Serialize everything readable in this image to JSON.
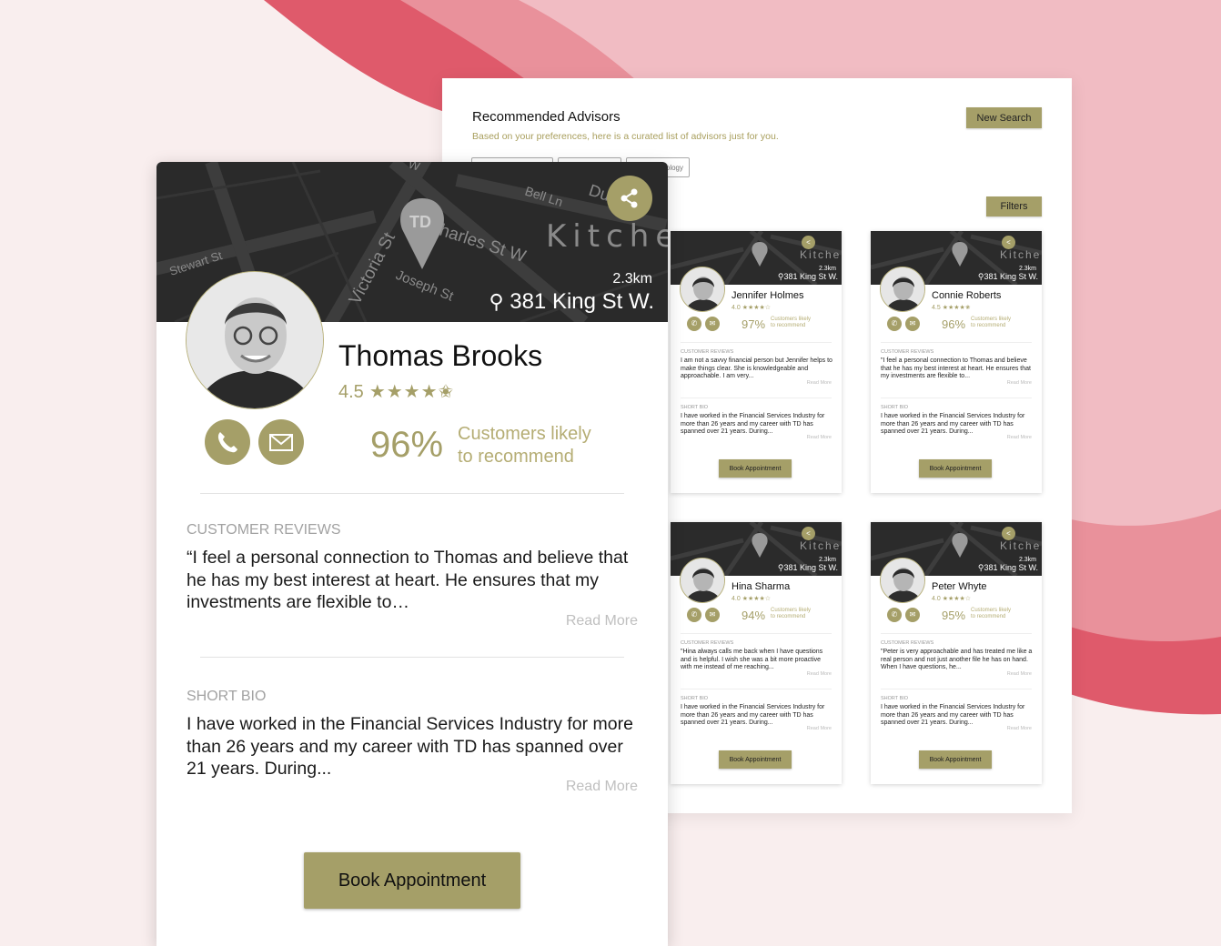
{
  "panel": {
    "title": "Recommended Advisors",
    "subtitle": "Based on your preferences, here is a curated list of advisors just for you.",
    "new_search": "New Search",
    "filters": "Filters",
    "chips": [
      "",
      "",
      "ology"
    ]
  },
  "labels": {
    "map_city": "Kitche",
    "customer_reviews_small": "CUSTOMER REVIEWS",
    "short_bio_small": "SHORT BIO",
    "customer_reviews": "CUSTOMER REVIEWS",
    "short_bio": "SHORT BIO",
    "read_more": "Read More",
    "likely_small": "Customers likely to recommend",
    "likely_l1": "Customers likely",
    "likely_l2": "to recommend",
    "book": "Book Appointment"
  },
  "streets": {
    "stewart": "Stewart St",
    "victoria": "Victoria St",
    "charles": "harles St W",
    "joseph": "Joseph St",
    "bell": "Bell Ln",
    "du": "Du",
    "w": "W"
  },
  "main": {
    "name": "Thomas Brooks",
    "rating": "4.5",
    "stars": "★★★★✬",
    "distance": "2.3km",
    "address": "381 King St W.",
    "percent": "96%",
    "review": "“I feel a personal connection to Thomas and believe that he has my best interest at heart. He ensures that my investments are flexible to…",
    "bio": "I have worked in the Financial Services Industry for more than 26 years and my career with TD has spanned over 21 years. During..."
  },
  "advisors": [
    {
      "name": "Jennifer Holmes",
      "rating": "4.0",
      "stars": "★★★★☆",
      "distance": "2.3km",
      "address": "381 King St W.",
      "percent": "97%",
      "review": "I am not a savvy financial person but Jennifer helps to make things clear. She is knowledgeable and approachable. I am very...",
      "bio": "I have worked in the Financial Services Industry for more than 26 years and my career with TD has spanned over 21 years. During..."
    },
    {
      "name": "Connie Roberts",
      "rating": "4.5",
      "stars": "★★★★✬",
      "distance": "2.3km",
      "address": "381 King St W.",
      "percent": "96%",
      "review": "\"I feel a personal connection to Thomas and believe that he has my best interest at heart. He ensures that my investments are flexible to...",
      "bio": "I have worked in the Financial Services Industry for more than 26 years and my career with TD has spanned over 21 years. During..."
    },
    {
      "name": "Hina Sharma",
      "rating": "4.0",
      "stars": "★★★★☆",
      "distance": "2.3km",
      "address": "381 King St W.",
      "percent": "94%",
      "review": "\"Hina always calls me back when I have questions and is helpful. I wish she was a bit more proactive with me instead of me reaching...",
      "bio": "I have worked in the Financial Services Industry for more than 26 years and my career with TD has spanned over 21 years. During..."
    },
    {
      "name": "Peter Whyte",
      "rating": "4.0",
      "stars": "★★★★☆",
      "distance": "2.3km",
      "address": "381 King St W.",
      "percent": "95%",
      "review": "\"Peter is very approachable and has treated me like a real person and not just another file he has on hand. When I have questions, he...",
      "bio": "I have worked in the Financial Services Industry for more than 26 years and my career with TD has spanned over 21 years. During..."
    }
  ],
  "colors": {
    "accent": "#a59f68",
    "wave_dark": "#df5a6b",
    "wave_mid": "#e9919b",
    "wave_light": "#f1bcc3",
    "background": "#f9eeee"
  }
}
